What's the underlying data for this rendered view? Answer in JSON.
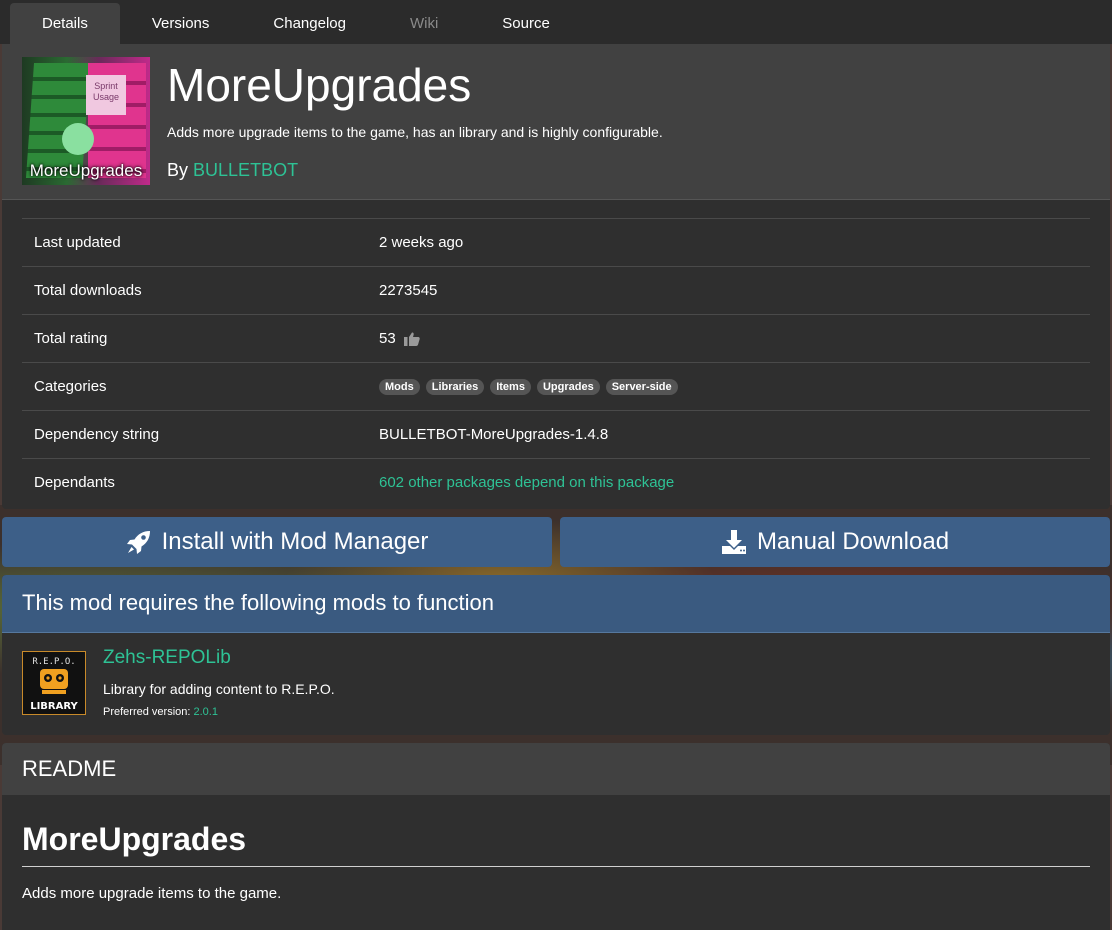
{
  "tabs": [
    {
      "label": "Details",
      "active": true
    },
    {
      "label": "Versions"
    },
    {
      "label": "Changelog"
    },
    {
      "label": "Wiki",
      "disabled": true
    },
    {
      "label": "Source"
    }
  ],
  "package": {
    "logo_caption": "MoreUpgrades",
    "logo_note": "Sprint Usage",
    "title": "MoreUpgrades",
    "description": "Adds more upgrade items to the game, has an library and is highly configurable.",
    "by_prefix": "By",
    "author": "BULLETBOT"
  },
  "info": {
    "last_updated_label": "Last updated",
    "last_updated_value": "2 weeks ago",
    "downloads_label": "Total downloads",
    "downloads_value": "2273545",
    "rating_label": "Total rating",
    "rating_value": "53",
    "categories_label": "Categories",
    "categories": [
      "Mods",
      "Libraries",
      "Items",
      "Upgrades",
      "Server-side"
    ],
    "dependency_label": "Dependency string",
    "dependency_value": "BULLETBOT-MoreUpgrades-1.4.8",
    "dependants_label": "Dependants",
    "dependants_value": "602 other packages depend on this package"
  },
  "buttons": {
    "install": "Install with Mod Manager",
    "download": "Manual Download"
  },
  "dependencies": {
    "header": "This mod requires the following mods to function",
    "items": [
      {
        "name": "Zehs-REPOLib",
        "description": "Library for adding content to R.E.P.O.",
        "version_label": "Preferred version:",
        "version": "2.0.1",
        "icon_top": "R.E.P.O.",
        "icon_bottom": "LIBRARY"
      }
    ]
  },
  "readme": {
    "header": "README",
    "title": "MoreUpgrades",
    "text": "Adds more upgrade items to the game."
  },
  "colors": {
    "accent_link": "#2ec295",
    "button_blue": "#3d5f88",
    "card_bg": "#2f2f2f"
  }
}
